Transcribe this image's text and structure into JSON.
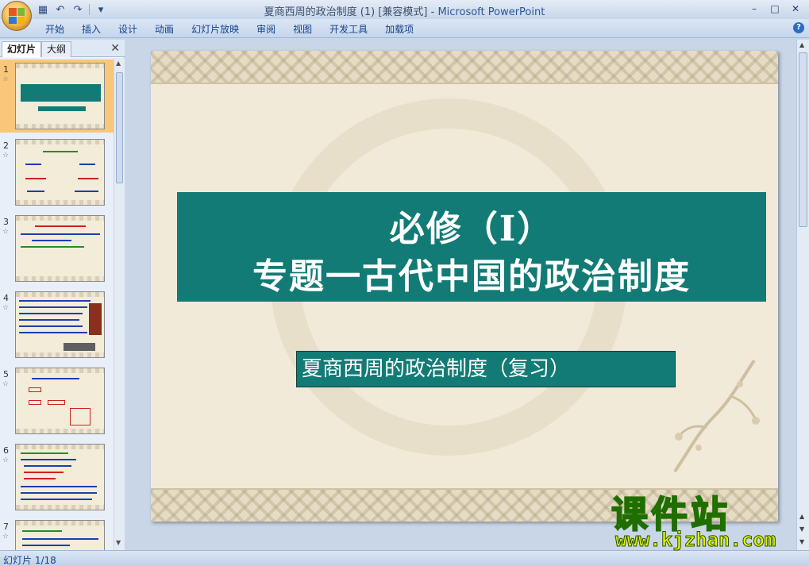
{
  "window": {
    "title": "夏商西周的政治制度 (1) [兼容模式] - ",
    "app": "Microsoft PowerPoint"
  },
  "ribbon": {
    "tabs": [
      "开始",
      "插入",
      "设计",
      "动画",
      "幻灯片放映",
      "审阅",
      "视图",
      "开发工具",
      "加载项"
    ]
  },
  "left_panel": {
    "tabs": [
      "幻灯片",
      "大纲"
    ],
    "slides": [
      "1",
      "2",
      "3",
      "4",
      "5",
      "6",
      "7"
    ],
    "selected_index": 1
  },
  "slide": {
    "title_line1": "必修（Ⅰ）",
    "title_line2": "专题一古代中国的政治制度",
    "subtitle": "夏商西周的政治制度（复习）"
  },
  "status": {
    "slide_counter": "幻灯片 1/18"
  },
  "brand": {
    "name": "课件站",
    "url": "www.kjzhan.com"
  },
  "colors": {
    "title_fill": "#137b76",
    "slide_bg": "#f2ead8",
    "selected_thumb": "#f9c77a"
  }
}
